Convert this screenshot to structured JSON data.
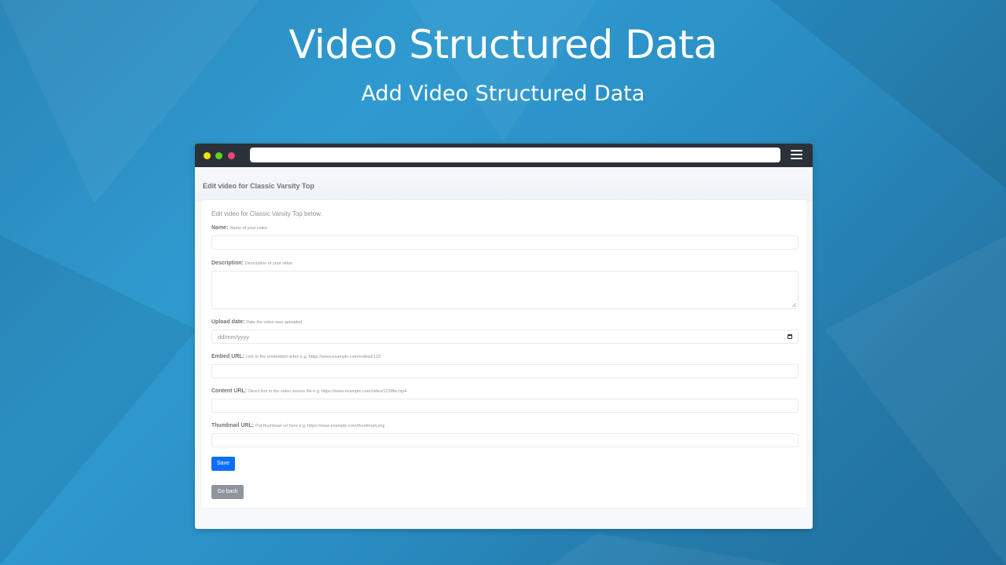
{
  "hero": {
    "title": "Video Structured Data",
    "subtitle": "Add Video Structured Data"
  },
  "browser": {
    "url": "",
    "traffic_lights": [
      "#f4e40a",
      "#5fd11f",
      "#f0447a"
    ],
    "menu_icon": "hamburger-menu-icon"
  },
  "page": {
    "header": "Edit video for Classic Varsity Top",
    "intro": "Edit video for Classic Varsity Top below.",
    "fields": [
      {
        "label": "Name:",
        "hint": "Name of your video",
        "value": "",
        "placeholder": ""
      },
      {
        "label": "Description:",
        "hint": "Description of your video",
        "value": "",
        "placeholder": ""
      },
      {
        "label": "Upload date:",
        "hint": "Date the video was uploaded",
        "value": "",
        "placeholder": "dd/mm/yyyy"
      },
      {
        "label": "Embed URL:",
        "hint": "Link to the embedded video e.g. https://www.example.com/embed/123",
        "value": "",
        "placeholder": ""
      },
      {
        "label": "Content URL:",
        "hint": "Direct link to the video source file e.g. https://www.example.com/video/123/file.mp4",
        "value": "",
        "placeholder": ""
      },
      {
        "label": "Thumbnail URL:",
        "hint": "Put thumbnail url here e.g. https://www.example.com/thumbnail.png",
        "value": "",
        "placeholder": ""
      }
    ],
    "save_label": "Save",
    "back_label": "Go back",
    "colors": {
      "primary": "#0d6efd",
      "secondary": "#8e959d"
    }
  }
}
